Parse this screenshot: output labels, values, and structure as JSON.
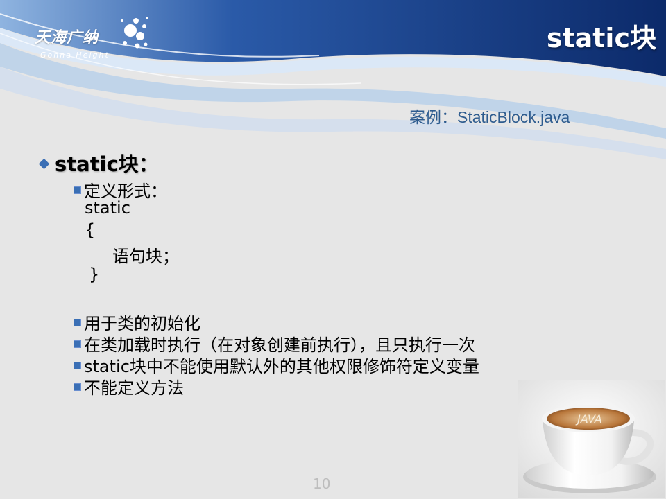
{
  "header": {
    "logo_cn": "天海广纳",
    "logo_en": "Gonna Height",
    "title": "static块"
  },
  "case_label": "案例：StaticBlock.java",
  "main_bullet": "static块：",
  "definition": {
    "label": "定义形式：",
    "lines": [
      "static",
      "{",
      "语句块；",
      "}"
    ]
  },
  "bullets": [
    "用于类的初始化",
    "在类加载时执行（在对象创建前执行），且只执行一次",
    "static块中不能使用默认外的其他权限修饰符定义变量",
    "不能定义方法"
  ],
  "cup_text": "JAVA",
  "page_number": "10",
  "colors": {
    "accent": "#3a6fb5",
    "banner_dark": "#0f2f72",
    "case_text": "#2e5c8f"
  },
  "icons": [
    "diamond-bullet-icon",
    "square-bullet-icon",
    "logo-dots-icon"
  ]
}
